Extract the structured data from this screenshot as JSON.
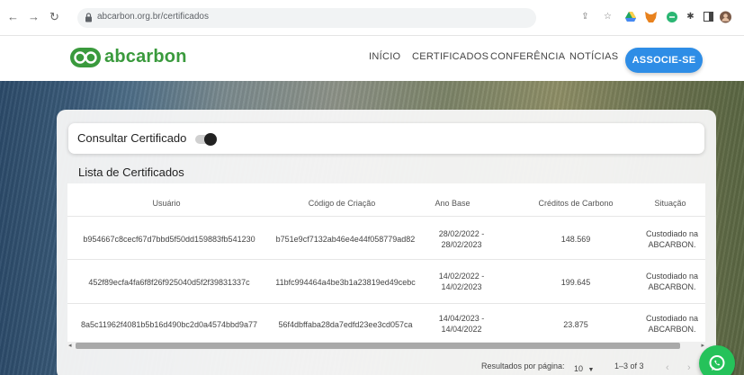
{
  "browser": {
    "back_icon": "arrow-left-icon",
    "forward_icon": "arrow-right-icon",
    "reload_icon": "reload-icon",
    "url": "abcarbon.org.br/certificados",
    "extensions": [
      "share-icon",
      "star-icon",
      "drive-icon",
      "metamask-icon",
      "green-ext-icon",
      "puzzle-icon",
      "sidebar-icon",
      "profile-avatar"
    ]
  },
  "site": {
    "brand": "abcarbon",
    "brand_color": "#3a9a3d",
    "nav": {
      "inicio": "INÍCIO",
      "certificados": "CERTIFICADOS",
      "conferencia": "CONFERÊNCIA",
      "noticias": "NOTÍCIAS"
    },
    "cta": "ASSOCIE-SE",
    "cta_color": "#2e8de6"
  },
  "consult": {
    "label": "Consultar Certificado",
    "toggle_on": false
  },
  "list": {
    "title": "Lista de Certificados",
    "columns": {
      "usuario": "Usuário",
      "codigo": "Código de Criação",
      "ano": "Ano Base",
      "creditos": "Créditos de Carbono",
      "situacao": "Situação"
    },
    "rows": [
      {
        "usuario": "b954667c8cecf67d7bbd5f50dd159883fb541230",
        "codigo": "b751e9cf7132ab46e4e44f058779ad82",
        "ano_1": "28/02/2022 -",
        "ano_2": "28/02/2023",
        "creditos": "148.569",
        "sit_1": "Custodiado na",
        "sit_2": "ABCARBON."
      },
      {
        "usuario": "452f89ecfa4fa6f8f26f925040d5f2f39831337c",
        "codigo": "11bfc994464a4be3b1a23819ed49cebc",
        "ano_1": "14/02/2022 -",
        "ano_2": "14/02/2023",
        "creditos": "199.645",
        "sit_1": "Custodiado na",
        "sit_2": "ABCARBON."
      },
      {
        "usuario": "8a5c11962f4081b5b16d490bc2d0a4574bbd9a77",
        "codigo": "56f4dbffaba28da7edfd23ee3cd057ca",
        "ano_1": "14/04/2023 -",
        "ano_2": "14/04/2022",
        "creditos": "23.875",
        "sit_1": "Custodiado na",
        "sit_2": "ABCARBON."
      }
    ]
  },
  "pagination": {
    "label": "Resultados por página:",
    "per_page": "10",
    "range": "1–3 of 3"
  },
  "whatsapp": {
    "icon": "whatsapp-icon",
    "color": "#25c25a"
  }
}
